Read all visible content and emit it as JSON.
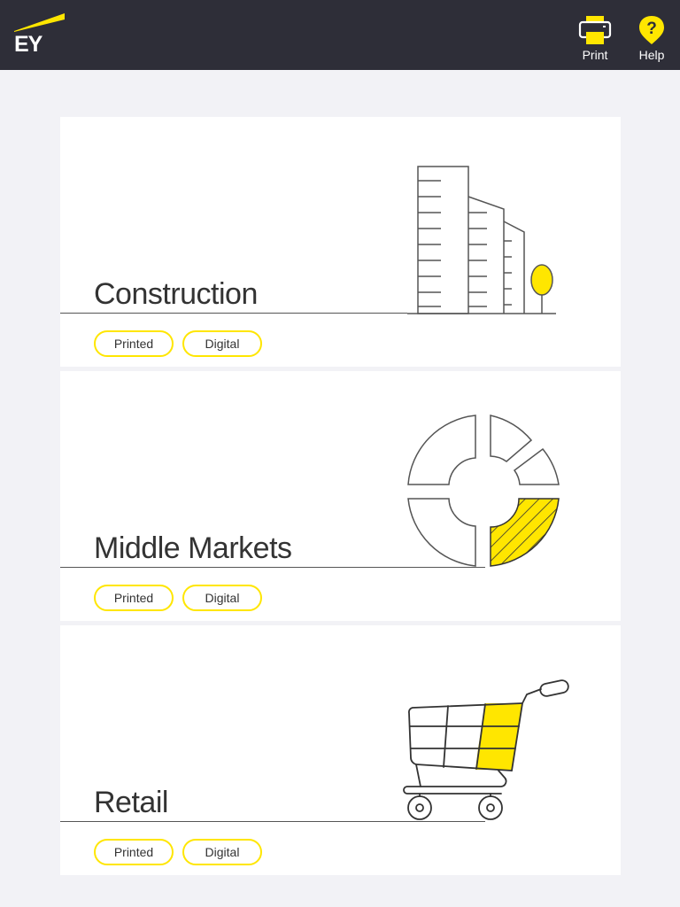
{
  "header": {
    "logo_text": "EY",
    "print_label": "Print",
    "help_label": "Help"
  },
  "colors": {
    "accent": "#ffe600",
    "header_bg": "#2e2e38",
    "page_bg": "#f2f2f6",
    "line": "#555555"
  },
  "cards": [
    {
      "title": "Construction",
      "printed_label": "Printed",
      "digital_label": "Digital",
      "icon": "buildings-icon"
    },
    {
      "title": "Middle Markets",
      "printed_label": "Printed",
      "digital_label": "Digital",
      "icon": "donut-chart-icon"
    },
    {
      "title": "Retail",
      "printed_label": "Printed",
      "digital_label": "Digital",
      "icon": "shopping-cart-icon"
    }
  ]
}
